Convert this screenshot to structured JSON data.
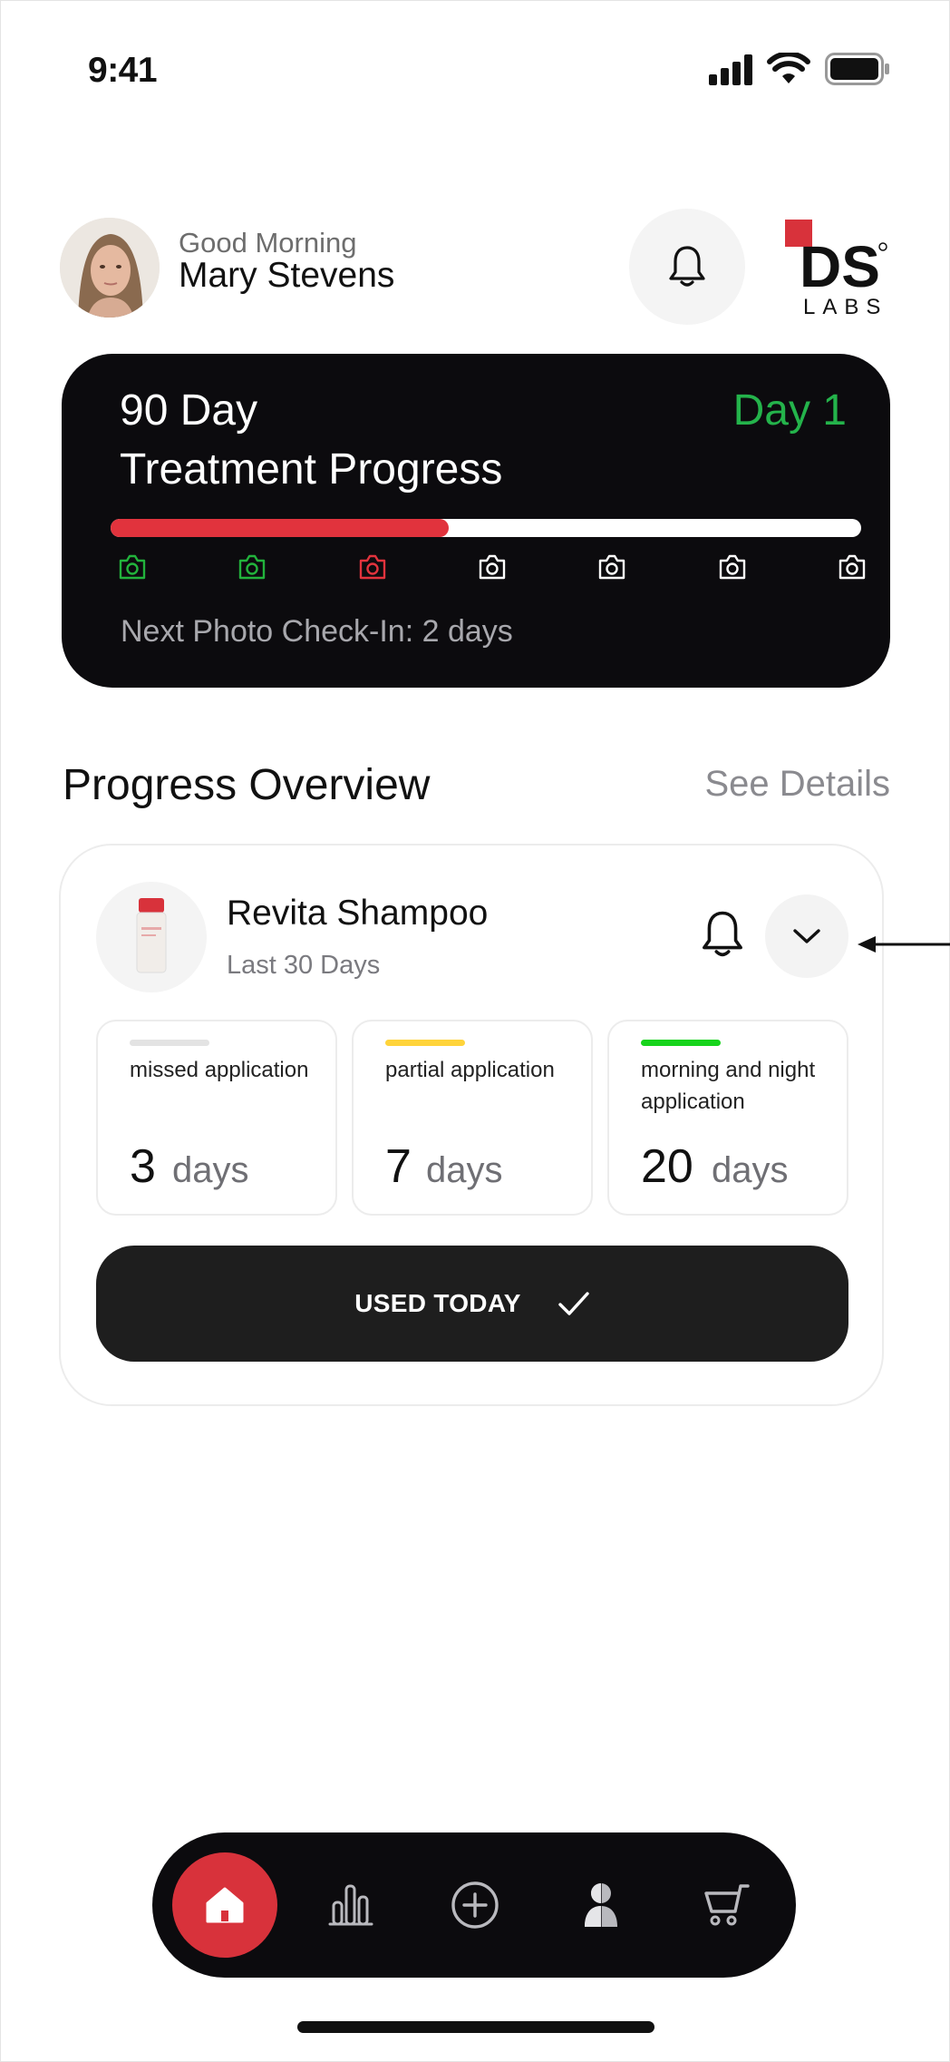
{
  "status_bar": {
    "time": "9:41"
  },
  "header": {
    "greeting": "Good Morning",
    "user_name": "Mary Stevens",
    "logo_text_top": "DS",
    "logo_text_bottom": "LABS"
  },
  "treatment": {
    "title_line1": "90 Day",
    "title_line2": "Treatment Progress",
    "day_label": "Day 1",
    "progress_fraction": 0.45,
    "checkins": [
      "done",
      "done",
      "missed",
      "upcoming",
      "upcoming",
      "upcoming",
      "upcoming"
    ],
    "next_checkin": "Next Photo Check-In: 2 days"
  },
  "overview": {
    "title": "Progress Overview",
    "see_details": "See Details"
  },
  "product": {
    "name": "Revita Shampoo",
    "period": "Last 30 Days",
    "stats": [
      {
        "label": "missed application",
        "value": "3",
        "unit": "days",
        "color": "#e3e3e3"
      },
      {
        "label": "partial application",
        "value": "7",
        "unit": "days",
        "color": "#ffd43b"
      },
      {
        "label": "morning and night application",
        "value": "20",
        "unit": "days",
        "color": "#17d41c"
      }
    ],
    "used_button": "USED TODAY"
  },
  "colors": {
    "accent_red": "#d8323b",
    "day_green": "#24b34b",
    "card_dark": "#0c0b0e"
  },
  "tabs": [
    "home-icon",
    "stats-icon",
    "add-icon",
    "profile-icon",
    "cart-icon"
  ]
}
